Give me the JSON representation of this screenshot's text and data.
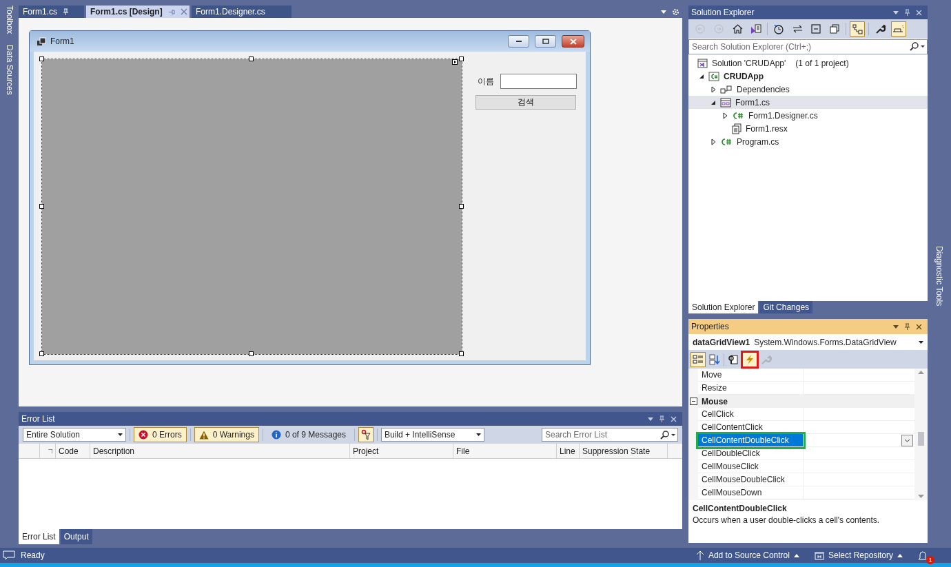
{
  "side_tabs_left": [
    "Toolbox",
    "Data Sources"
  ],
  "side_tabs_right": [
    "Diagnostic Tools"
  ],
  "doc_tabs": [
    {
      "label": "Form1.cs",
      "selected": false,
      "pinned": true
    },
    {
      "label": "Form1.cs [Design]",
      "selected": true,
      "pinned": false
    },
    {
      "label": "Form1.Designer.cs",
      "selected": false,
      "pinned": false
    }
  ],
  "designer": {
    "form_title": "Form1",
    "name_label": "이름",
    "search_button": "검색"
  },
  "solution_explorer": {
    "title": "Solution Explorer",
    "search_placeholder": "Search Solution Explorer (Ctrl+;)",
    "toolbar": [
      {
        "kind": "back",
        "disabled": true,
        "selected": false
      },
      {
        "kind": "forward",
        "disabled": true,
        "selected": false
      },
      {
        "kind": "home",
        "disabled": false,
        "selected": false
      },
      {
        "kind": "switch-views",
        "disabled": false,
        "selected": false
      },
      {
        "kind": "history",
        "disabled": false,
        "selected": false
      },
      {
        "kind": "sync",
        "disabled": false,
        "selected": false
      },
      {
        "kind": "collapse",
        "disabled": false,
        "selected": false
      },
      {
        "kind": "copies",
        "disabled": false,
        "selected": false
      },
      {
        "kind": "show-all",
        "disabled": false,
        "selected": true
      },
      {
        "kind": "properties",
        "disabled": false,
        "selected": false
      },
      {
        "kind": "preview",
        "disabled": false,
        "selected": true
      }
    ],
    "tree": [
      {
        "label": "Solution 'CRUDApp'",
        "note": "(1 of 1 project)",
        "kind": "solution",
        "selected": false,
        "children": [
          {
            "label": "CRUDApp",
            "kind": "project",
            "expanded": true,
            "selected": false,
            "children": [
              {
                "label": "Dependencies",
                "kind": "dependencies",
                "expanded": false,
                "selected": false
              },
              {
                "label": "Form1.cs",
                "kind": "form",
                "expanded": true,
                "selected": true,
                "children": [
                  {
                    "label": "Form1.Designer.cs",
                    "kind": "csharp",
                    "expanded": false,
                    "selected": false
                  },
                  {
                    "label": "Form1.resx",
                    "kind": "resource",
                    "selected": false
                  }
                ]
              },
              {
                "label": "Program.cs",
                "kind": "csharp",
                "expanded": false,
                "selected": false
              }
            ]
          }
        ]
      }
    ],
    "tabs": [
      {
        "label": "Solution Explorer",
        "selected": true
      },
      {
        "label": "Git Changes",
        "selected": false
      }
    ]
  },
  "properties": {
    "title": "Properties",
    "object_name": "dataGridView1",
    "object_type": "System.Windows.Forms.DataGridView",
    "toolbar": [
      {
        "kind": "categorized",
        "selected": true,
        "disabled": false,
        "highlighted": false
      },
      {
        "kind": "alphabetical",
        "selected": false,
        "disabled": false,
        "highlighted": false
      },
      {
        "kind": "property-list",
        "selected": false,
        "disabled": false,
        "highlighted": false
      },
      {
        "kind": "events",
        "selected": true,
        "disabled": false,
        "highlighted": true
      },
      {
        "kind": "property-pages",
        "selected": false,
        "disabled": true,
        "highlighted": false
      }
    ],
    "rows": [
      {
        "kind": "item",
        "name": "Move",
        "selected": false,
        "highlighted": false
      },
      {
        "kind": "item",
        "name": "Resize",
        "selected": false,
        "highlighted": false
      },
      {
        "kind": "category",
        "name": "Mouse",
        "expanded": true
      },
      {
        "kind": "item",
        "name": "CellClick",
        "selected": false,
        "highlighted": false
      },
      {
        "kind": "item",
        "name": "CellContentClick",
        "selected": false,
        "highlighted": false
      },
      {
        "kind": "item",
        "name": "CellContentDoubleClick",
        "selected": true,
        "highlighted": true
      },
      {
        "kind": "item",
        "name": "CellDoubleClick",
        "selected": false,
        "highlighted": false
      },
      {
        "kind": "item",
        "name": "CellMouseClick",
        "selected": false,
        "highlighted": false
      },
      {
        "kind": "item",
        "name": "CellMouseDoubleClick",
        "selected": false,
        "highlighted": false
      },
      {
        "kind": "item",
        "name": "CellMouseDown",
        "selected": false,
        "highlighted": false
      }
    ],
    "description": {
      "title": "CellContentDoubleClick",
      "text": "Occurs when a user double-clicks a cell's contents."
    }
  },
  "error_list": {
    "title": "Error List",
    "scope": "Entire Solution",
    "filters": [
      {
        "kind": "error",
        "label": "0 Errors",
        "selected": true
      },
      {
        "kind": "warning",
        "label": "0 Warnings",
        "selected": true
      },
      {
        "kind": "info",
        "label": "0 of 9 Messages",
        "selected": false
      }
    ],
    "filter_toggle": {
      "selected": true
    },
    "source": "Build + IntelliSense",
    "search_placeholder": "Search Error List",
    "columns": [
      "Code",
      "Description",
      "Project",
      "File",
      "Line",
      "Suppression State"
    ],
    "tabs": [
      {
        "label": "Error List",
        "selected": true
      },
      {
        "label": "Output",
        "selected": false
      }
    ]
  },
  "status_bar": {
    "text": "Ready",
    "source_control": "Add to Source Control",
    "repository": "Select Repository",
    "notifications": "1"
  }
}
